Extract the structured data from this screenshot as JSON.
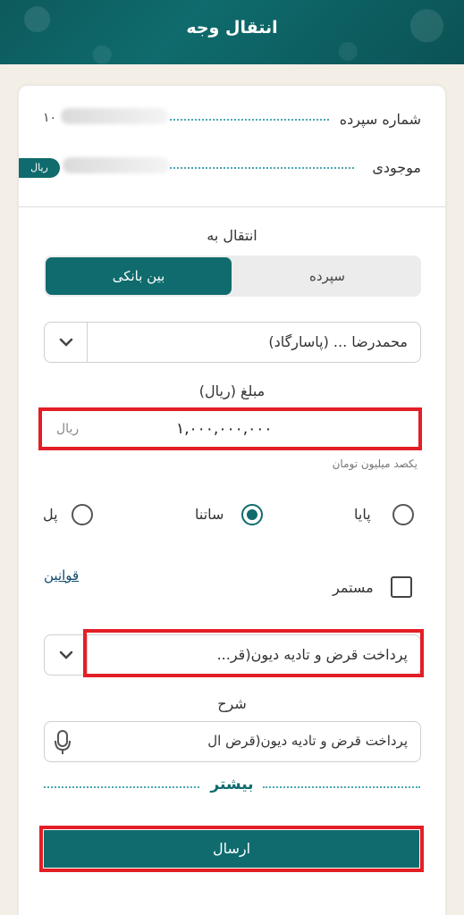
{
  "header": {
    "title": "انتقال وجه"
  },
  "account": {
    "deposit_label": "شماره سپرده",
    "deposit_value_start": "۱۰",
    "balance_label": "موجودی",
    "balance_currency": "ریال"
  },
  "transfer": {
    "to_label": "انتقال به",
    "tabs": [
      {
        "label": "بین بانکی",
        "active": true
      },
      {
        "label": "سپرده",
        "active": false
      }
    ],
    "destination_value": "محمدرضا ... (پاسارگاد)"
  },
  "amount": {
    "label": "مبلغ (ریال)",
    "value": "۱,۰۰۰,۰۰۰,۰۰۰",
    "unit": "ریال",
    "hint": "یکصد میلیون تومان"
  },
  "methods": [
    {
      "label": "پایا",
      "selected": false
    },
    {
      "label": "ساتنا",
      "selected": true
    },
    {
      "label": "پل",
      "selected": false
    }
  ],
  "options": {
    "continuous_label": "مستمر",
    "continuous_checked": false,
    "rules_link": "قوانین"
  },
  "reason": {
    "selected": "پرداخت قرض و تادیه دیون(قر..."
  },
  "description": {
    "label": "شرح",
    "value": "پرداخت قرض و تادیه دیون(قرض ال"
  },
  "more_label": "بیشتر",
  "submit_label": "ارسال",
  "colors": {
    "primary": "#0f6b6d",
    "highlight": "#e31e25"
  },
  "icons": {
    "dropdown": "chevron-down-icon",
    "mic": "microphone-icon"
  }
}
